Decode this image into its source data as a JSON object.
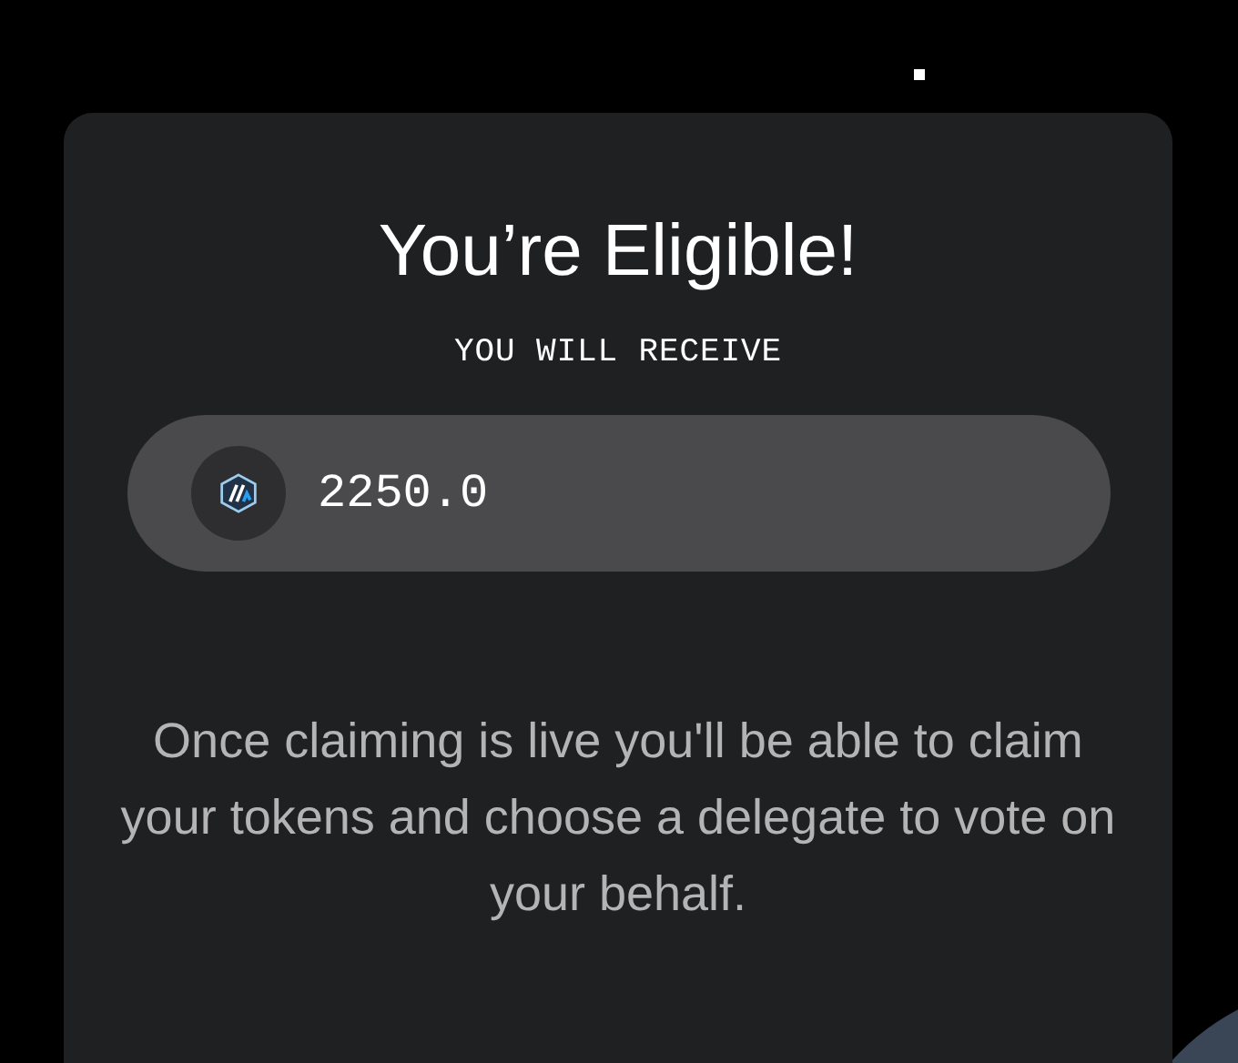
{
  "title": "You’re Eligible!",
  "subtitle": "YOU WILL RECEIVE",
  "amount": "2250.0",
  "message": "Once claiming is live you'll be able to claim your tokens and choose a delegate to vote on your behalf."
}
